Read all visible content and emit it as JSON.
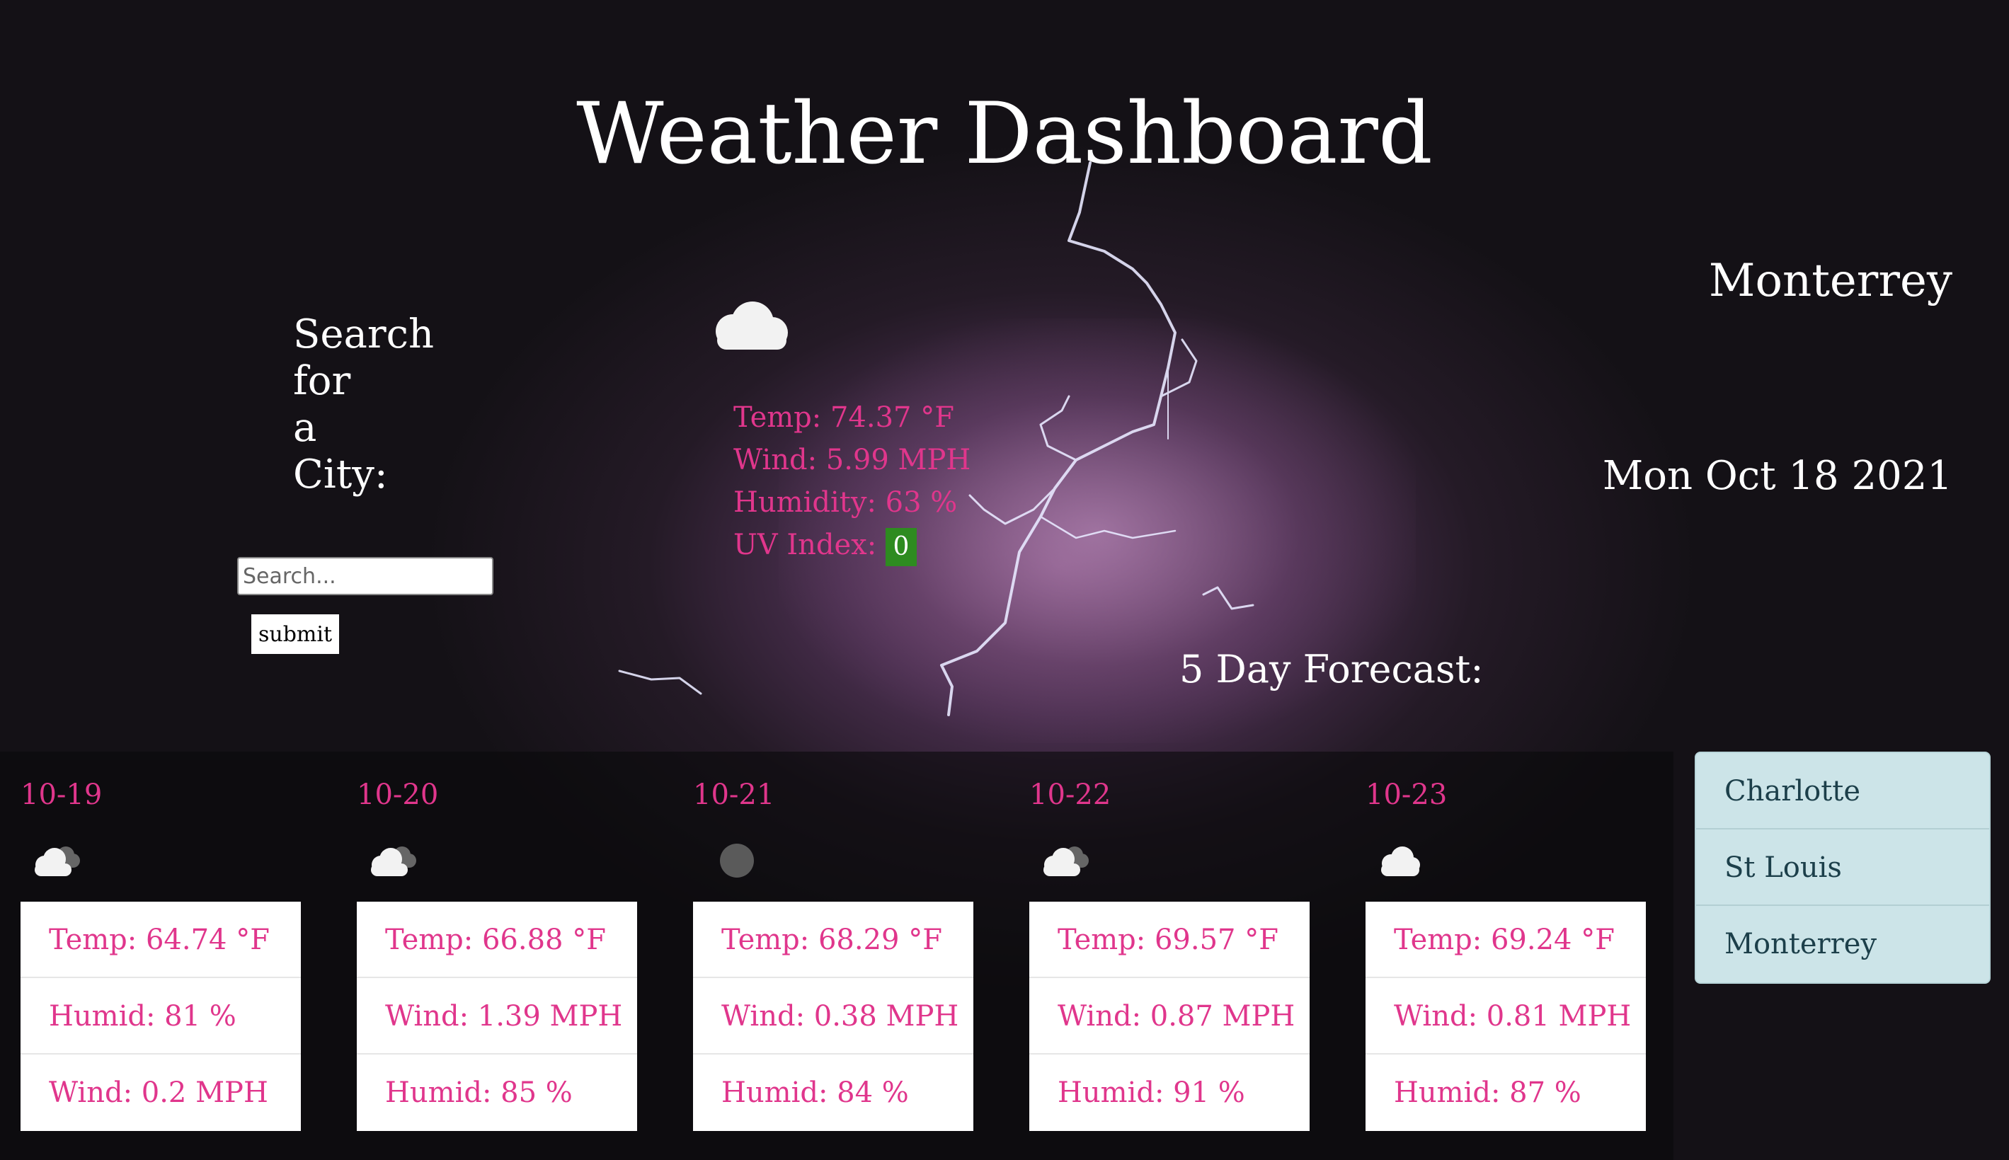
{
  "header": {
    "title": "Weather Dashboard"
  },
  "search": {
    "label_lines": [
      "Search",
      "for",
      "a",
      "City:"
    ],
    "placeholder": "Search...",
    "submit_label": "submit"
  },
  "current": {
    "city": "Monterrey",
    "date": "Mon Oct 18 2021",
    "icon": "cloud-icon",
    "temp": "Temp: 74.37 °F",
    "wind": "Wind: 5.99 MPH",
    "humidity": "Humidity: 63 %",
    "uv_label": "UV Index:",
    "uv_value": "0",
    "uv_color": "#2e8b20"
  },
  "forecast": {
    "title": "5 Day Forecast:",
    "days": [
      {
        "date": "10-19",
        "icon": "partly-cloudy-icon",
        "lines": [
          "Temp: 64.74 °F",
          "Humid: 81 %",
          "Wind: 0.2 MPH"
        ]
      },
      {
        "date": "10-20",
        "icon": "partly-cloudy-icon",
        "lines": [
          "Temp: 66.88 °F",
          "Wind: 1.39 MPH",
          "Humid: 85 %"
        ]
      },
      {
        "date": "10-21",
        "icon": "overcast-icon",
        "lines": [
          "Temp: 68.29 °F",
          "Wind: 0.38 MPH",
          "Humid: 84 %"
        ]
      },
      {
        "date": "10-22",
        "icon": "partly-cloudy-icon",
        "lines": [
          "Temp: 69.57 °F",
          "Wind: 0.87 MPH",
          "Humid: 91 %"
        ]
      },
      {
        "date": "10-23",
        "icon": "cloud-icon",
        "lines": [
          "Temp: 69.24 °F",
          "Wind: 0.81 MPH",
          "Humid: 87 %"
        ]
      }
    ]
  },
  "history": [
    "Charlotte",
    "St Louis",
    "Monterrey"
  ],
  "colors": {
    "accent": "#e0368c",
    "history_bg": "#cce4e8",
    "uv_green": "#2e8b20"
  }
}
